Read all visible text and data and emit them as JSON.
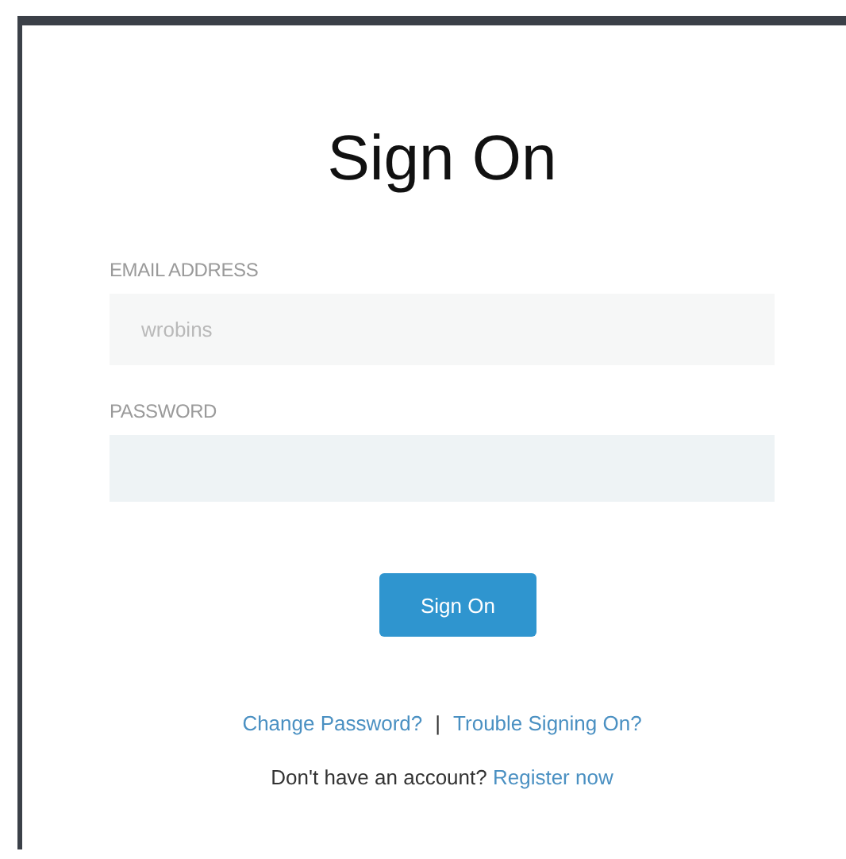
{
  "title": "Sign On",
  "fields": [
    {
      "label": "EMAIL ADDRESS",
      "value": "wrobins",
      "kind": "text"
    },
    {
      "label": "PASSWORD",
      "kind": "password"
    }
  ],
  "button": "Sign On",
  "help_links": [
    {
      "text": "Change Password?"
    },
    {
      "text": "Trouble Signing On?"
    }
  ],
  "separator": "|",
  "account_prompt": {
    "text": "Don't have an account?",
    "link": "Register now"
  }
}
